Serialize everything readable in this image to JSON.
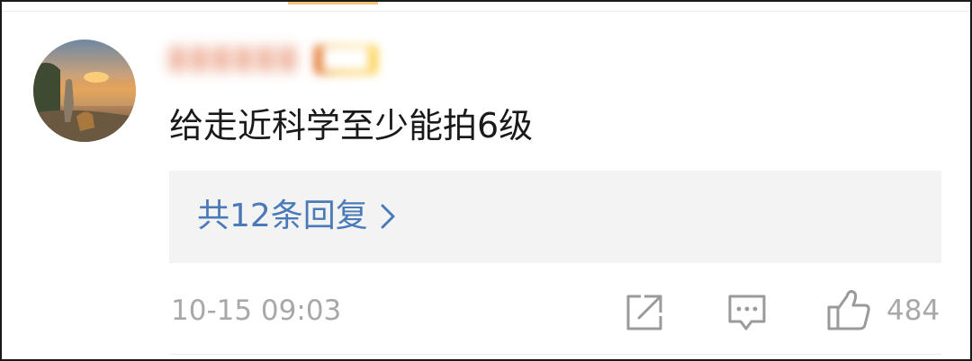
{
  "comment": {
    "author": {
      "name": "██████",
      "badge": "███"
    },
    "text": "给走近科学至少能拍6级",
    "replies_label": "共12条回复",
    "timestamp": "10-15 09:03",
    "like_count": "484"
  },
  "icons": {
    "share": "share-icon",
    "reply": "comment-icon",
    "like": "thumbs-up-icon",
    "chevron": "chevron-right-icon"
  },
  "colors": {
    "reply_link": "#4a7ab8",
    "meta_text": "#a8a8a8",
    "reply_panel": "#f3f3f3"
  }
}
